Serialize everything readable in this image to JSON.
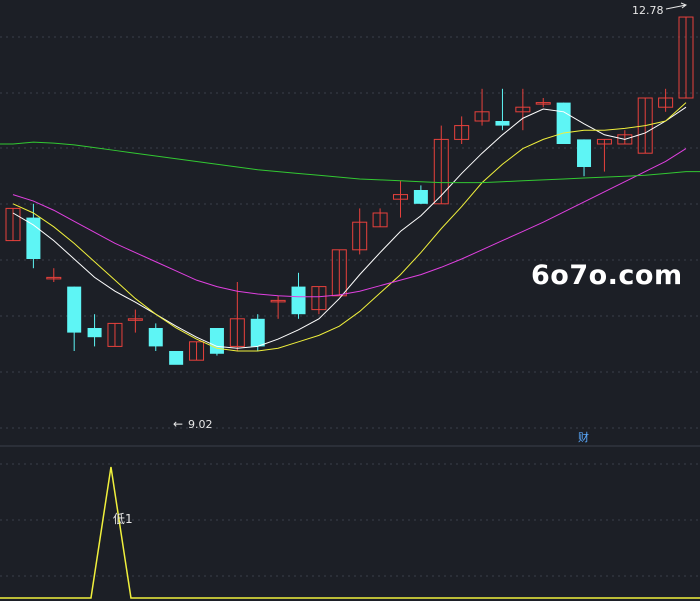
{
  "chart_data": {
    "type": "candlestick",
    "price_axis": {
      "min": 8.4,
      "max": 12.9
    },
    "candles": [
      {
        "open": 10.35,
        "close": 10.7,
        "high": 10.7,
        "low": 10.35
      },
      {
        "open": 10.6,
        "close": 10.15,
        "high": 10.75,
        "low": 10.05
      },
      {
        "open": 9.95,
        "close": 9.95,
        "high": 10.05,
        "low": 9.9
      },
      {
        "open": 9.85,
        "close": 9.35,
        "high": 9.85,
        "low": 9.15
      },
      {
        "open": 9.4,
        "close": 9.3,
        "high": 9.55,
        "low": 9.2
      },
      {
        "open": 9.2,
        "close": 9.45,
        "high": 9.45,
        "low": 9.2
      },
      {
        "open": 9.5,
        "close": 9.5,
        "high": 9.6,
        "low": 9.35
      },
      {
        "open": 9.4,
        "close": 9.2,
        "high": 9.45,
        "low": 9.15
      },
      {
        "open": 9.15,
        "close": 9.0,
        "high": 9.15,
        "low": 9.02
      },
      {
        "open": 9.05,
        "close": 9.25,
        "high": 9.25,
        "low": 9.05
      },
      {
        "open": 9.4,
        "close": 9.12,
        "high": 9.4,
        "low": 9.1
      },
      {
        "open": 9.2,
        "close": 9.5,
        "high": 9.9,
        "low": 9.15
      },
      {
        "open": 9.5,
        "close": 9.2,
        "high": 9.55,
        "low": 9.15
      },
      {
        "open": 9.7,
        "close": 9.7,
        "high": 9.75,
        "low": 9.5
      },
      {
        "open": 9.85,
        "close": 9.55,
        "high": 10.0,
        "low": 9.5
      },
      {
        "open": 9.6,
        "close": 9.85,
        "high": 9.85,
        "low": 9.55
      },
      {
        "open": 9.75,
        "close": 10.25,
        "high": 10.25,
        "low": 9.75
      },
      {
        "open": 10.25,
        "close": 10.55,
        "high": 10.7,
        "low": 10.2
      },
      {
        "open": 10.5,
        "close": 10.65,
        "high": 10.7,
        "low": 10.5
      },
      {
        "open": 10.8,
        "close": 10.85,
        "high": 11.0,
        "low": 10.6
      },
      {
        "open": 10.9,
        "close": 10.75,
        "high": 10.95,
        "low": 10.75
      },
      {
        "open": 10.75,
        "close": 11.45,
        "high": 11.6,
        "low": 10.75
      },
      {
        "open": 11.45,
        "close": 11.6,
        "high": 11.7,
        "low": 11.4
      },
      {
        "open": 11.65,
        "close": 11.75,
        "high": 12.0,
        "low": 11.6
      },
      {
        "open": 11.65,
        "close": 11.6,
        "high": 12.0,
        "low": 11.55
      },
      {
        "open": 11.75,
        "close": 11.8,
        "high": 12.0,
        "low": 11.55
      },
      {
        "open": 11.85,
        "close": 11.85,
        "high": 11.9,
        "low": 11.8
      },
      {
        "open": 11.85,
        "close": 11.4,
        "high": 11.85,
        "low": 11.4
      },
      {
        "open": 11.45,
        "close": 11.15,
        "high": 11.45,
        "low": 11.05
      },
      {
        "open": 11.4,
        "close": 11.45,
        "high": 11.45,
        "low": 11.1
      },
      {
        "open": 11.4,
        "close": 11.5,
        "high": 11.55,
        "low": 11.4
      },
      {
        "open": 11.3,
        "close": 11.9,
        "high": 11.9,
        "low": 11.3
      },
      {
        "open": 11.8,
        "close": 11.9,
        "high": 12.0,
        "low": 11.75
      },
      {
        "open": 11.9,
        "close": 12.78,
        "high": 12.78,
        "low": 11.9
      }
    ],
    "moving_averages": [
      {
        "color": "#ffffff",
        "values": [
          10.65,
          10.52,
          10.35,
          10.15,
          9.95,
          9.8,
          9.68,
          9.55,
          9.42,
          9.3,
          9.2,
          9.18,
          9.2,
          9.28,
          9.38,
          9.5,
          9.72,
          9.98,
          10.22,
          10.45,
          10.62,
          10.84,
          11.08,
          11.3,
          11.5,
          11.68,
          11.78,
          11.75,
          11.62,
          11.5,
          11.45,
          11.52,
          11.65,
          11.8
        ]
      },
      {
        "color": "#f0f03c",
        "values": [
          10.75,
          10.65,
          10.5,
          10.32,
          10.12,
          9.92,
          9.72,
          9.55,
          9.4,
          9.28,
          9.18,
          9.15,
          9.15,
          9.18,
          9.25,
          9.32,
          9.42,
          9.58,
          9.78,
          9.98,
          10.22,
          10.48,
          10.72,
          10.98,
          11.18,
          11.35,
          11.45,
          11.52,
          11.55,
          11.55,
          11.57,
          11.6,
          11.65,
          11.85
        ]
      },
      {
        "color": "#e040e0",
        "values": [
          10.85,
          10.78,
          10.68,
          10.56,
          10.44,
          10.32,
          10.22,
          10.12,
          10.02,
          9.92,
          9.85,
          9.8,
          9.77,
          9.75,
          9.74,
          9.74,
          9.76,
          9.8,
          9.86,
          9.92,
          9.98,
          10.06,
          10.15,
          10.25,
          10.35,
          10.45,
          10.55,
          10.66,
          10.77,
          10.88,
          10.99,
          11.1,
          11.21,
          11.35
        ]
      },
      {
        "color": "#32c832",
        "values": [
          11.4,
          11.42,
          11.41,
          11.39,
          11.36,
          11.33,
          11.3,
          11.27,
          11.24,
          11.21,
          11.18,
          11.15,
          11.12,
          11.1,
          11.08,
          11.06,
          11.04,
          11.02,
          11.01,
          11.0,
          10.99,
          10.98,
          10.98,
          10.98,
          10.99,
          11.0,
          11.01,
          11.02,
          11.03,
          11.04,
          11.05,
          11.06,
          11.08,
          11.1
        ]
      }
    ],
    "annotations": {
      "high_label": "12.78",
      "low_label": "9.02",
      "low_arrow": "←",
      "cai_marker": "财",
      "signal_label": "低1"
    },
    "indicator": {
      "color": "#f0f03c",
      "signal_index": 5
    }
  },
  "watermark": "6o7o.com"
}
